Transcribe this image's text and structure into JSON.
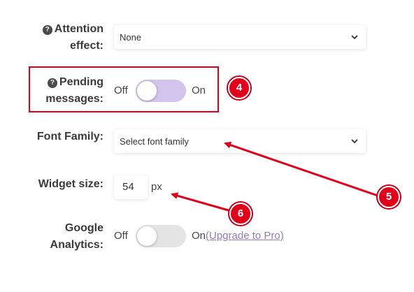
{
  "attention_effect": {
    "label_line1": "Attention",
    "label_line2": "effect:",
    "value": "None",
    "help_icon": "question-circle-icon"
  },
  "pending_messages": {
    "label_line1": "Pending",
    "label_line2": "messages:",
    "off_label": "Off",
    "on_label": "On",
    "state": "off",
    "help_icon": "question-circle-icon"
  },
  "font_family": {
    "label": "Font Family:",
    "placeholder": "Select font family"
  },
  "widget_size": {
    "label": "Widget size:",
    "value": "54",
    "unit": "px"
  },
  "google_analytics": {
    "label_line1": "Google",
    "label_line2": "Analytics:",
    "off_label": "Off",
    "on_label": "On",
    "upgrade_link": "(Upgrade to Pro)",
    "state": "off"
  },
  "annotations": {
    "badge_4": "4",
    "badge_5": "5",
    "badge_6": "6"
  },
  "colors": {
    "annotation_red": "#e0001b",
    "toggle_active_track": "#d2c4ea",
    "toggle_disabled_track": "#e4e4e4",
    "link": "#8e7ac4"
  }
}
